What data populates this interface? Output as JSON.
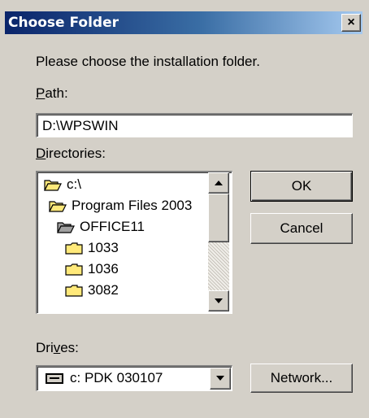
{
  "window": {
    "title": "Choose Folder",
    "close_glyph": "×"
  },
  "prompt": "Please choose the installation folder.",
  "path": {
    "label_first": "P",
    "label_rest": "ath:",
    "value": "D:\\WPSWIN"
  },
  "directories": {
    "label_first": "D",
    "label_rest": "irectories:",
    "items": [
      {
        "name": "c:\\",
        "icon": "open-folder-icon"
      },
      {
        "name": "Program Files 2003",
        "icon": "open-folder-icon"
      },
      {
        "name": "OFFICE11",
        "icon": "open-folder-selected-icon"
      },
      {
        "name": "1033",
        "icon": "closed-folder-icon"
      },
      {
        "name": "1036",
        "icon": "closed-folder-icon"
      },
      {
        "name": "3082",
        "icon": "closed-folder-icon"
      }
    ]
  },
  "buttons": {
    "ok": "OK",
    "cancel": "Cancel",
    "network": "Network..."
  },
  "drives": {
    "label_first": "Dri",
    "label_u": "v",
    "label_rest": "es:",
    "selected": "c: PDK 030107"
  },
  "colors": {
    "titlebar_start": "#0a246a",
    "titlebar_end": "#a6caf0",
    "face": "#d4d0c8",
    "folder": "#ffe97a"
  }
}
